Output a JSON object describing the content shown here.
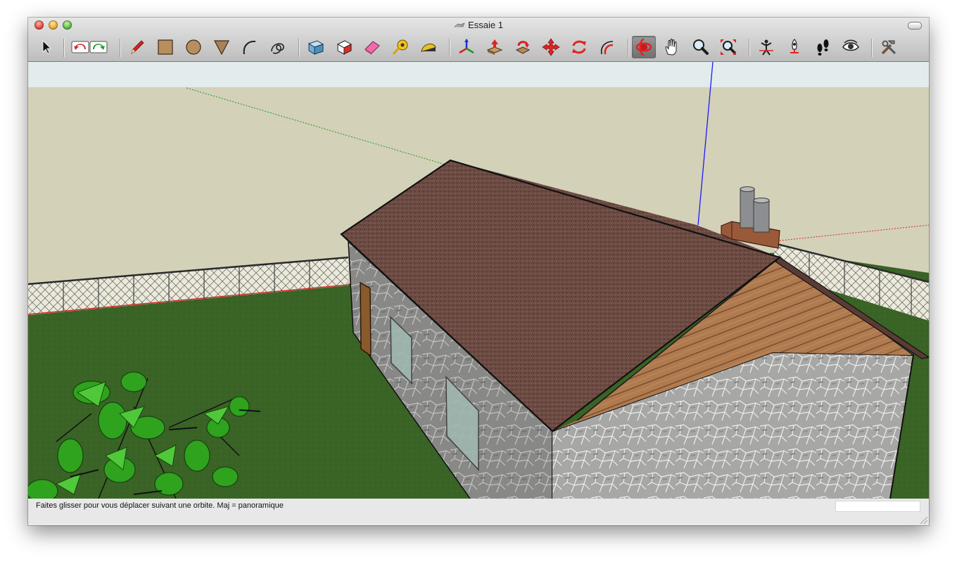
{
  "window": {
    "title": "Essaie 1"
  },
  "toolbar": {
    "tools": [
      {
        "name": "select-tool-icon"
      },
      {
        "name": "undo-icon"
      },
      {
        "name": "redo-icon"
      },
      {
        "name": "pencil-icon"
      },
      {
        "name": "rectangle-icon"
      },
      {
        "name": "circle-icon"
      },
      {
        "name": "polygon-icon"
      },
      {
        "name": "arc-icon"
      },
      {
        "name": "freehand-icon"
      },
      {
        "name": "make-component-icon"
      },
      {
        "name": "paint-bucket-icon"
      },
      {
        "name": "eraser-icon"
      },
      {
        "name": "tape-measure-icon"
      },
      {
        "name": "protractor-icon"
      },
      {
        "name": "axes-icon"
      },
      {
        "name": "push-pull-icon"
      },
      {
        "name": "follow-me-icon"
      },
      {
        "name": "move-icon"
      },
      {
        "name": "rotate-icon"
      },
      {
        "name": "offset-icon"
      },
      {
        "name": "orbit-icon",
        "active": true
      },
      {
        "name": "pan-hand-icon"
      },
      {
        "name": "zoom-icon"
      },
      {
        "name": "zoom-extents-icon"
      },
      {
        "name": "position-camera-icon"
      },
      {
        "name": "walk-icon"
      },
      {
        "name": "footprints-icon"
      },
      {
        "name": "look-around-icon"
      },
      {
        "name": "preferences-tools-icon"
      }
    ]
  },
  "status": {
    "hint": "Faites glisser pour vous déplacer suivant une orbite.  Maj = panoramique",
    "measurements_value": ""
  },
  "scene": {
    "sky_color": "#e3ecec",
    "ground_color": "#d4d1b9",
    "grass_color": "#3a6326",
    "roof_color": "#6b4a42",
    "gable_wood_color": "#b07a4f",
    "wall_stone_color": "#9c9c9c",
    "axis_blue": "#1a1aff",
    "axis_green": "#1c9a1c",
    "axis_red": "#d42a2a"
  }
}
